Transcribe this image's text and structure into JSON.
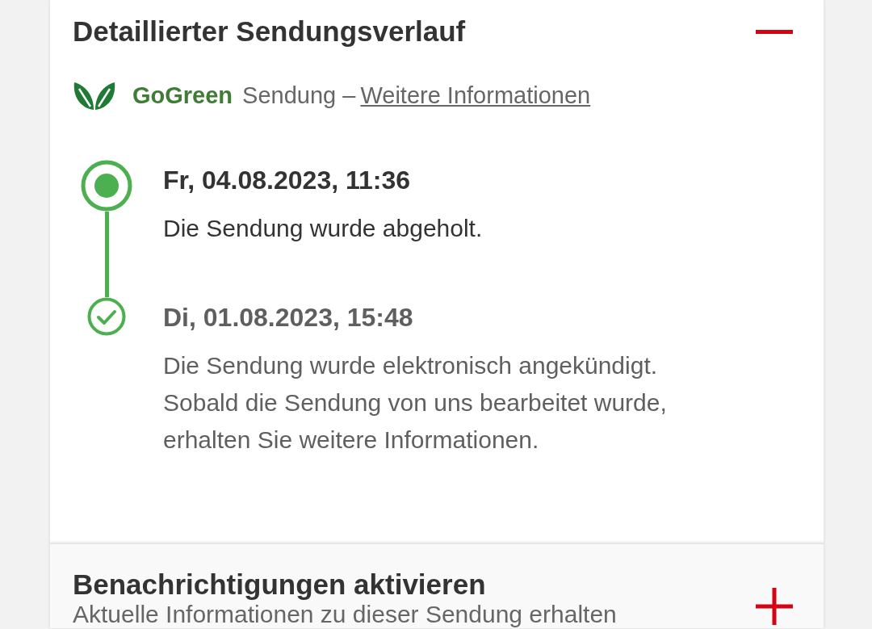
{
  "history": {
    "title": "Detaillierter Sendungsverlauf",
    "expanded": true,
    "gogreen": {
      "brand": "GoGreen",
      "text": "Sendung –",
      "link": "Weitere Informationen"
    },
    "events": [
      {
        "kind": "current",
        "date": "Fr, 04.08.2023, 11:36",
        "text": "Die Sendung wurde abgeholt."
      },
      {
        "kind": "done",
        "date": "Di, 01.08.2023, 15:48",
        "text": "Die Sendung wurde elektronisch angekündigt. Sobald die Sendung von uns bearbeitet wurde, erhalten Sie weitere Informationen."
      }
    ]
  },
  "notifications": {
    "title": "Benachrichtigungen aktivieren",
    "expanded": false,
    "description": "Aktuelle Informationen zu dieser Sendung erhalten"
  }
}
